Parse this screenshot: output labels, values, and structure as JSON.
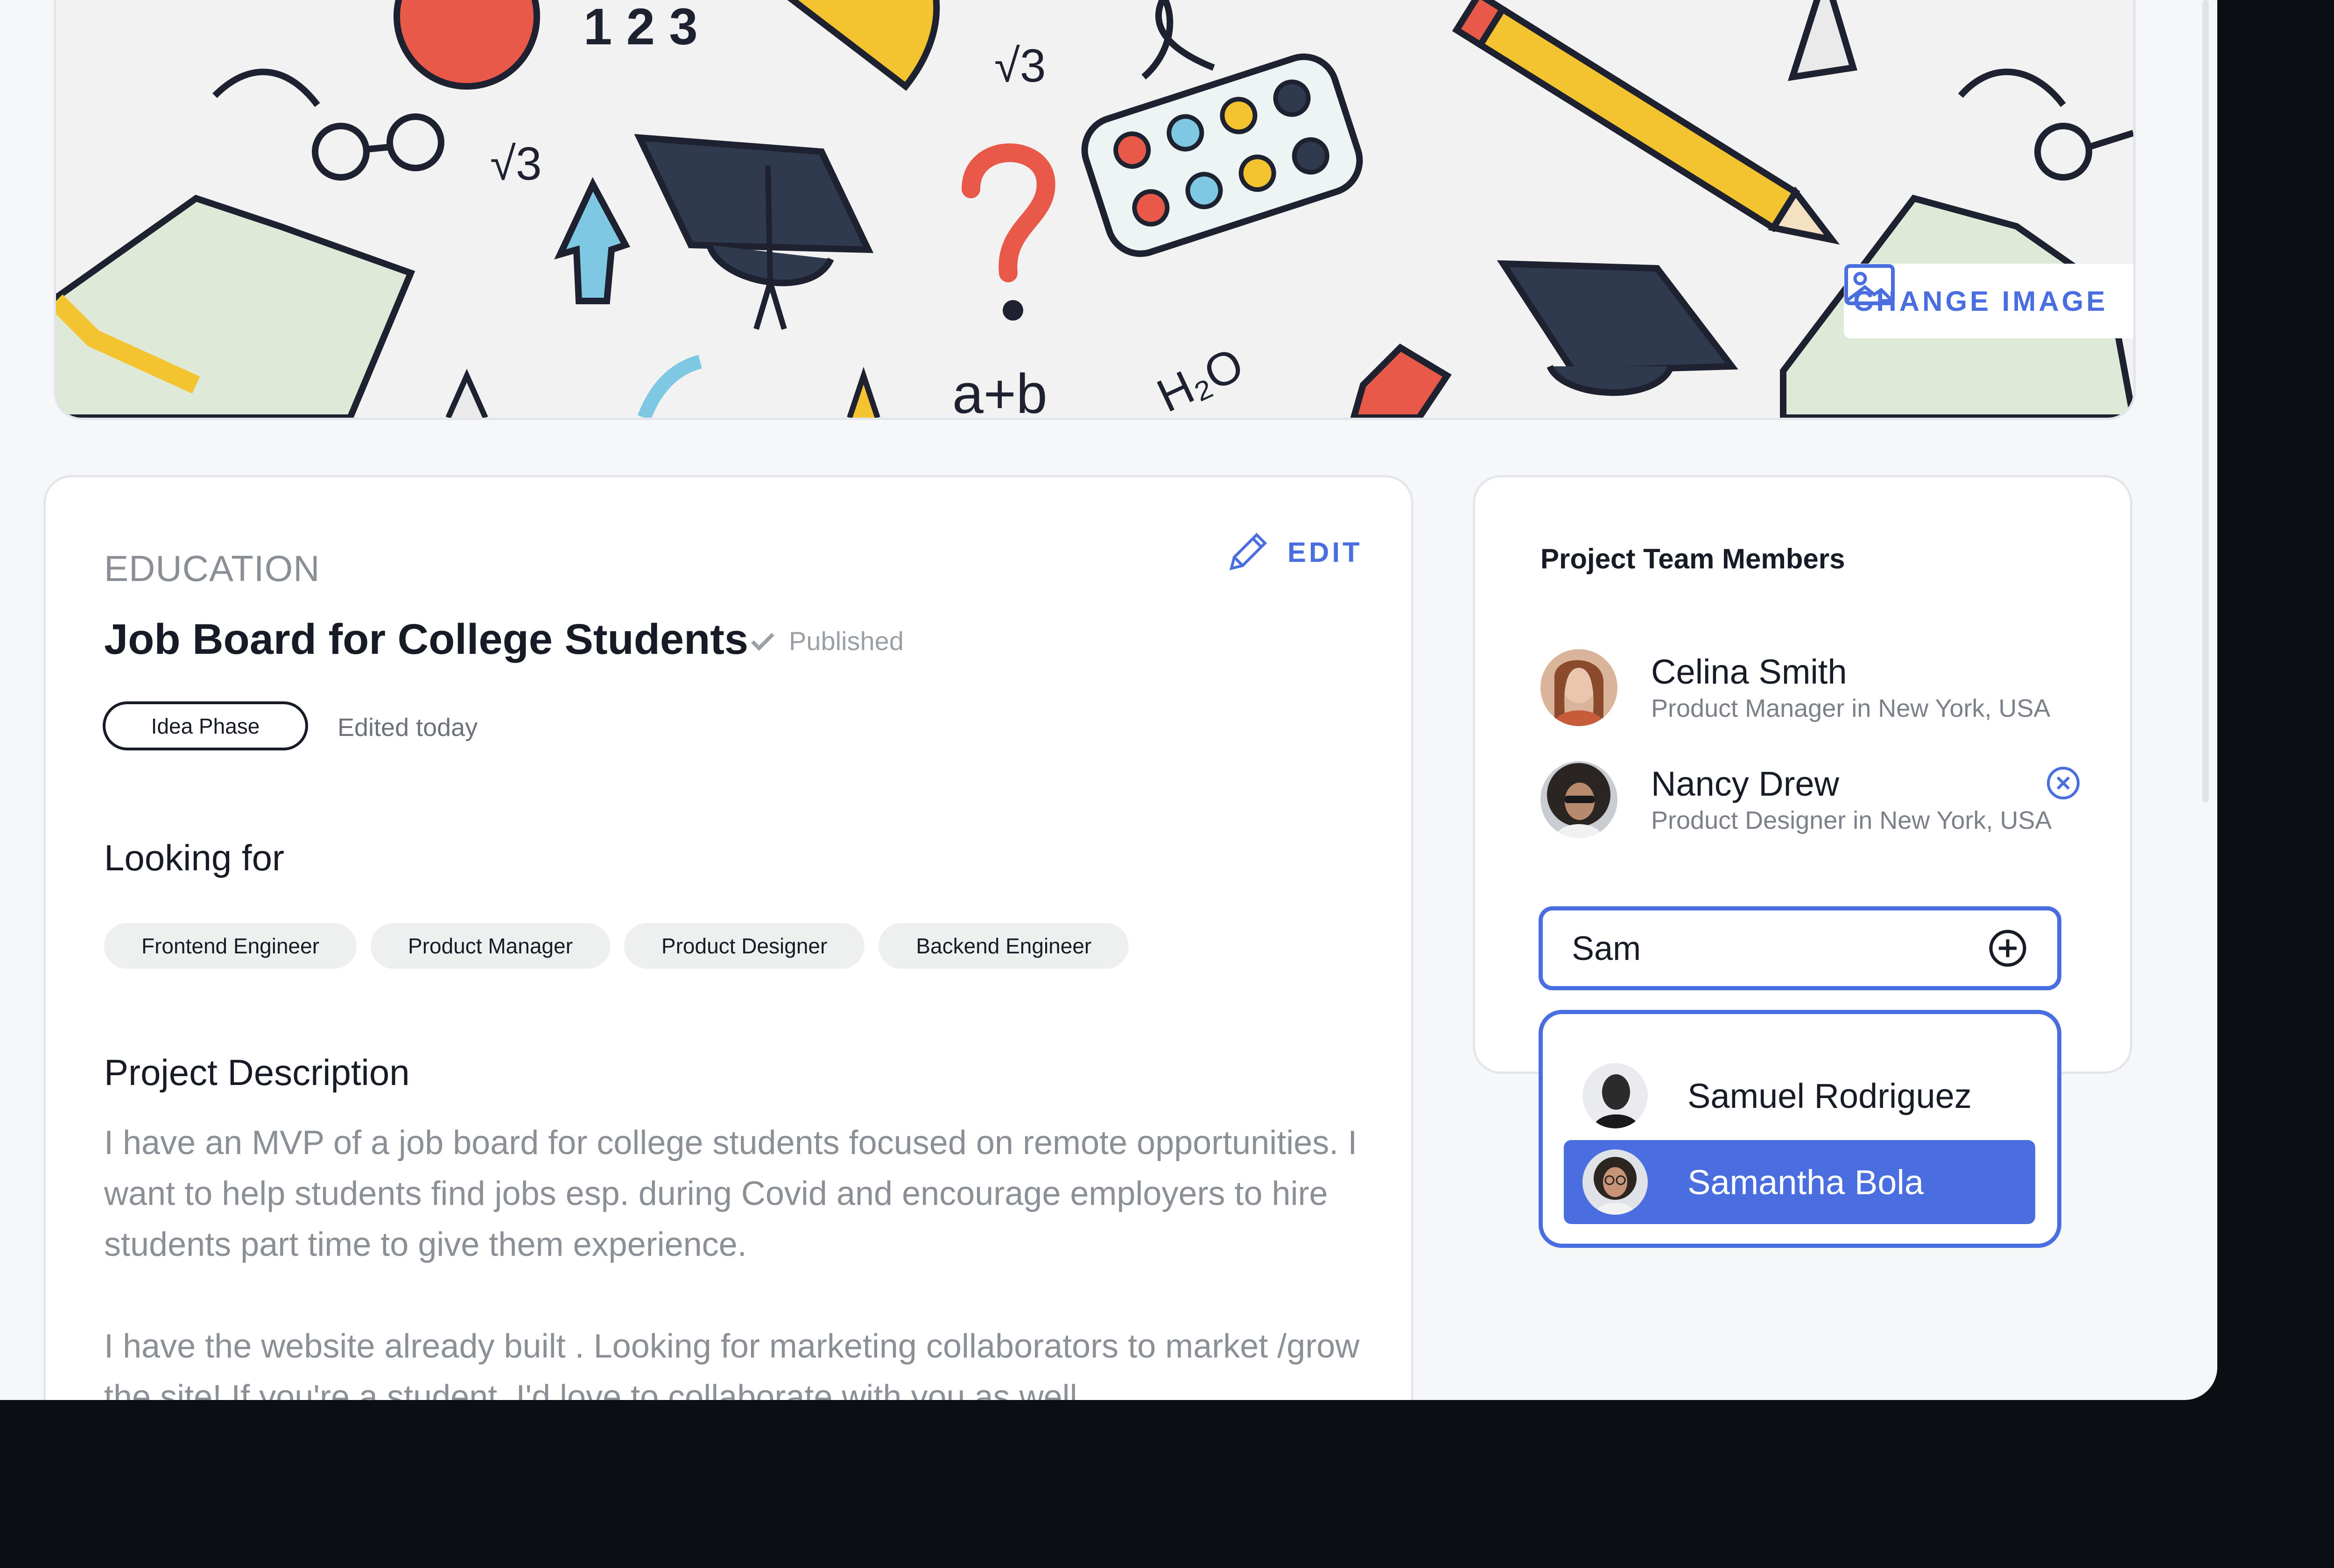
{
  "cover": {
    "change_image_label": "CHANGE IMAGE",
    "doodle_text": {
      "numbers": "1 2 3",
      "sqrt_a": "√3",
      "sqrt_b": "√3",
      "formula": "a+b",
      "water": "H₂O"
    }
  },
  "project": {
    "category": "EDUCATION",
    "title": "Job Board for College Students",
    "status": "Published",
    "edit_label": "EDIT",
    "phase": "Idea Phase",
    "edited": "Edited today",
    "looking_for_heading": "Looking for",
    "roles": [
      "Frontend Engineer",
      "Product Manager",
      "Product Designer",
      "Backend Engineer"
    ],
    "description_heading": "Project Description",
    "description": [
      "I have an MVP of a job board for college students focused on remote opportunities. I want to help students find jobs esp. during Covid and encourage employers to hire students part time to give them experience.",
      "I have the website already built . Looking for marketing collaborators to market /grow the site! If you're a student, I'd love to collaborate with you as well."
    ]
  },
  "team": {
    "title": "Project Team Members",
    "members": [
      {
        "name": "Celina Smith",
        "role": "Product Manager in New York, USA"
      },
      {
        "name": "Nancy Drew",
        "role": "Product Designer in New York, USA"
      }
    ],
    "search_value": "Sam",
    "suggestions": [
      {
        "name": "Samuel Rodriguez",
        "selected": false
      },
      {
        "name": "Samantha Bola",
        "selected": true
      }
    ]
  },
  "colors": {
    "accent": "#4a6ee0",
    "text": "#161b26",
    "muted": "#8b8f96",
    "backdrop": "#0b0f14",
    "page": "#f6f7f9"
  },
  "icons": [
    "image-icon",
    "pencil-icon",
    "checkmark-icon",
    "remove-circle-icon",
    "add-circle-icon"
  ]
}
